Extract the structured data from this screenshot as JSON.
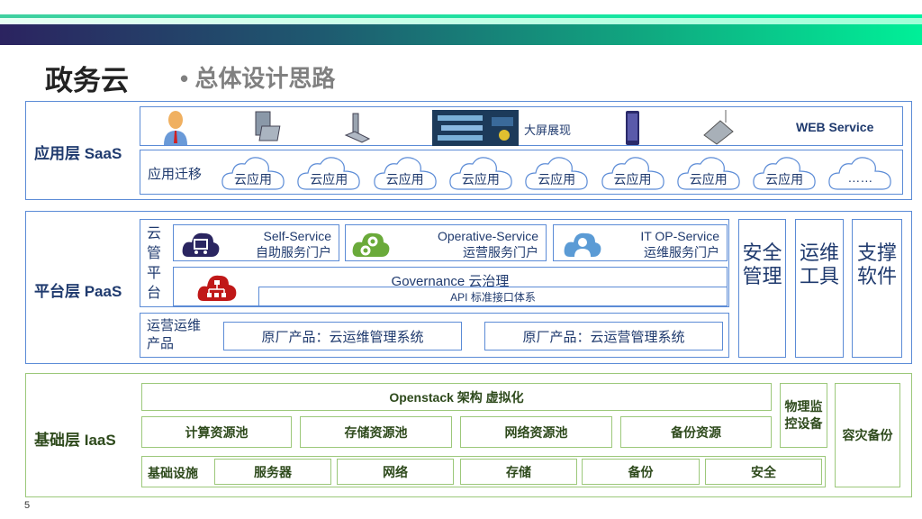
{
  "header": {
    "title": "政务云",
    "subtitle": "• 总体设计思路"
  },
  "saas": {
    "label": "应用层 SaaS",
    "devices": [
      {
        "icon": "user-icon"
      },
      {
        "icon": "desktop-icon"
      },
      {
        "icon": "laptop-icon"
      },
      {
        "icon": "big-screen-icon"
      },
      {
        "icon": "tablet-icon"
      },
      {
        "icon": "pda-icon"
      }
    ],
    "big_screen_label": "大屏展现",
    "web_service": "WEB Service",
    "migration_label": "应用迁移",
    "clouds": [
      "云应用",
      "云应用",
      "云应用",
      "云应用",
      "云应用",
      "云应用",
      "云应用",
      "云应用",
      "……"
    ]
  },
  "paas": {
    "label": "平台层 PaaS",
    "cmp_label": "云管平台",
    "services": [
      {
        "en": "Self-Service",
        "cn": "自助服务门户",
        "icon": "cart-cloud-icon",
        "color": "#2a2560"
      },
      {
        "en": "Operative-Service",
        "cn": "运营服务门户",
        "icon": "gear-cloud-icon",
        "color": "#6aaa3a"
      },
      {
        "en": "IT OP-Service",
        "cn": "运维服务门户",
        "icon": "support-cloud-icon",
        "color": "#5b9bd5"
      }
    ],
    "governance": "Governance 云治理",
    "api": "API 标准接口体系",
    "ops_label": "运营运维产品",
    "products": [
      "原厂产品：云运维管理系统",
      "原厂产品：云运营管理系统"
    ],
    "side": [
      "安全管理",
      "运维工具",
      "支撑软件"
    ]
  },
  "iaas": {
    "label": "基础层 IaaS",
    "openstack": "Openstack 架构 虚拟化",
    "pools": [
      "计算资源池",
      "存储资源池",
      "网络资源池",
      "备份资源"
    ],
    "infra_label": "基础设施",
    "infra": [
      "服务器",
      "网络",
      "存储",
      "备份",
      "安全"
    ],
    "monitor": "物理监控设备",
    "dr": "容灾备份"
  },
  "page_number": "5"
}
